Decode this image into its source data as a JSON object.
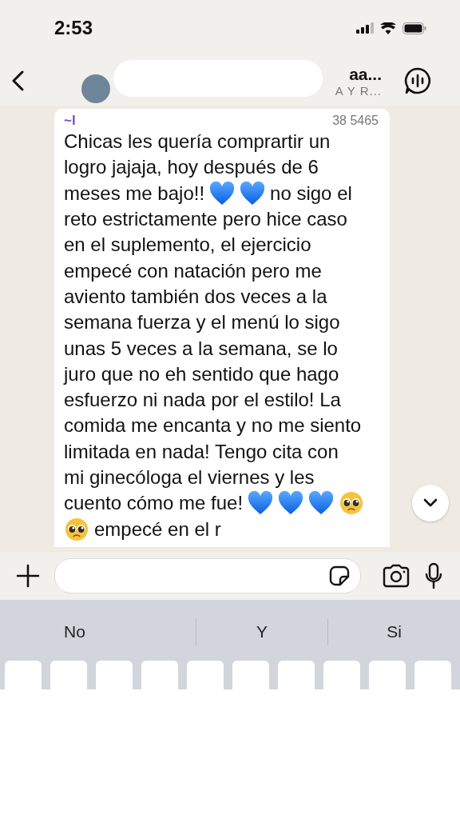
{
  "status_bar": {
    "time": "2:53"
  },
  "header": {
    "title": "aa...",
    "subtitle": "A Y R..."
  },
  "message": {
    "sender": "~l",
    "phone": "38 5465",
    "lines": [
      [
        {
          "kind": "text",
          "text": "Chicas les quería comprartir un"
        }
      ],
      [
        {
          "kind": "text",
          "text": "logro jajaja, hoy después de 6"
        }
      ],
      [
        {
          "kind": "text",
          "text": "meses me bajo!!"
        },
        {
          "kind": "heart"
        },
        {
          "kind": "heart"
        },
        {
          "kind": "text",
          "text": "no sigo el"
        }
      ],
      [
        {
          "kind": "text",
          "text": "reto estrictamente pero hice caso"
        }
      ],
      [
        {
          "kind": "text",
          "text": "en el suplemento, el ejercicio"
        }
      ],
      [
        {
          "kind": "text",
          "text": "empecé con natación pero me"
        }
      ],
      [
        {
          "kind": "text",
          "text": "aviento también dos veces a la"
        }
      ],
      [
        {
          "kind": "text",
          "text": "semana fuerza y el menú lo sigo"
        }
      ],
      [
        {
          "kind": "text",
          "text": "unas 5 veces a la semana, se lo"
        }
      ],
      [
        {
          "kind": "text",
          "text": "juro que no eh sentido que hago"
        }
      ],
      [
        {
          "kind": "text",
          "text": "esfuerzo ni nada por el estilo! La"
        }
      ],
      [
        {
          "kind": "text",
          "text": "comida me encanta y no me siento"
        }
      ],
      [
        {
          "kind": "text",
          "text": "limitada en nada! Tengo cita con"
        }
      ],
      [
        {
          "kind": "text",
          "text": "mi ginecóloga el viernes y les"
        }
      ],
      [
        {
          "kind": "text",
          "text": "cuento cómo me fue!"
        },
        {
          "kind": "heart"
        },
        {
          "kind": "heart"
        },
        {
          "kind": "heart"
        },
        {
          "kind": "pleading"
        }
      ],
      [
        {
          "kind": "pleading"
        },
        {
          "kind": "text",
          "text": "empecé en el r"
        }
      ]
    ]
  },
  "suggestions": [
    "No",
    "Y",
    "Si"
  ]
}
